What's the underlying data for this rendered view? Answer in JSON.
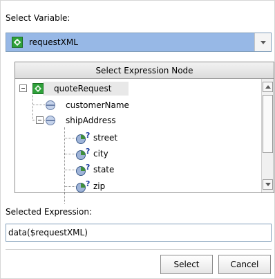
{
  "select_variable_label": "Select Variable:",
  "variable": {
    "selected": "requestXML",
    "icon": "xml-variable-icon"
  },
  "tree": {
    "header": "Select Expression Node",
    "nodes": [
      {
        "label": "quoteRequest",
        "icon": "xml-variable-icon",
        "expanded": true,
        "selected": true
      },
      {
        "label": "customerName",
        "icon": "element-icon"
      },
      {
        "label": "shipAddress",
        "icon": "element-icon",
        "expanded": true
      },
      {
        "label": "street",
        "icon": "optional-attribute-icon"
      },
      {
        "label": "city",
        "icon": "optional-attribute-icon"
      },
      {
        "label": "state",
        "icon": "optional-attribute-icon"
      },
      {
        "label": "zip",
        "icon": "optional-attribute-icon"
      }
    ]
  },
  "selected_expression_label": "Selected Expression:",
  "selected_expression_value": "data($requestXML)",
  "buttons": {
    "select": "Select",
    "cancel": "Cancel"
  },
  "colors": {
    "combo_highlight": "#97b8e6",
    "xml_icon": "#2fa13a",
    "element_icon": "#9fb4d8"
  }
}
